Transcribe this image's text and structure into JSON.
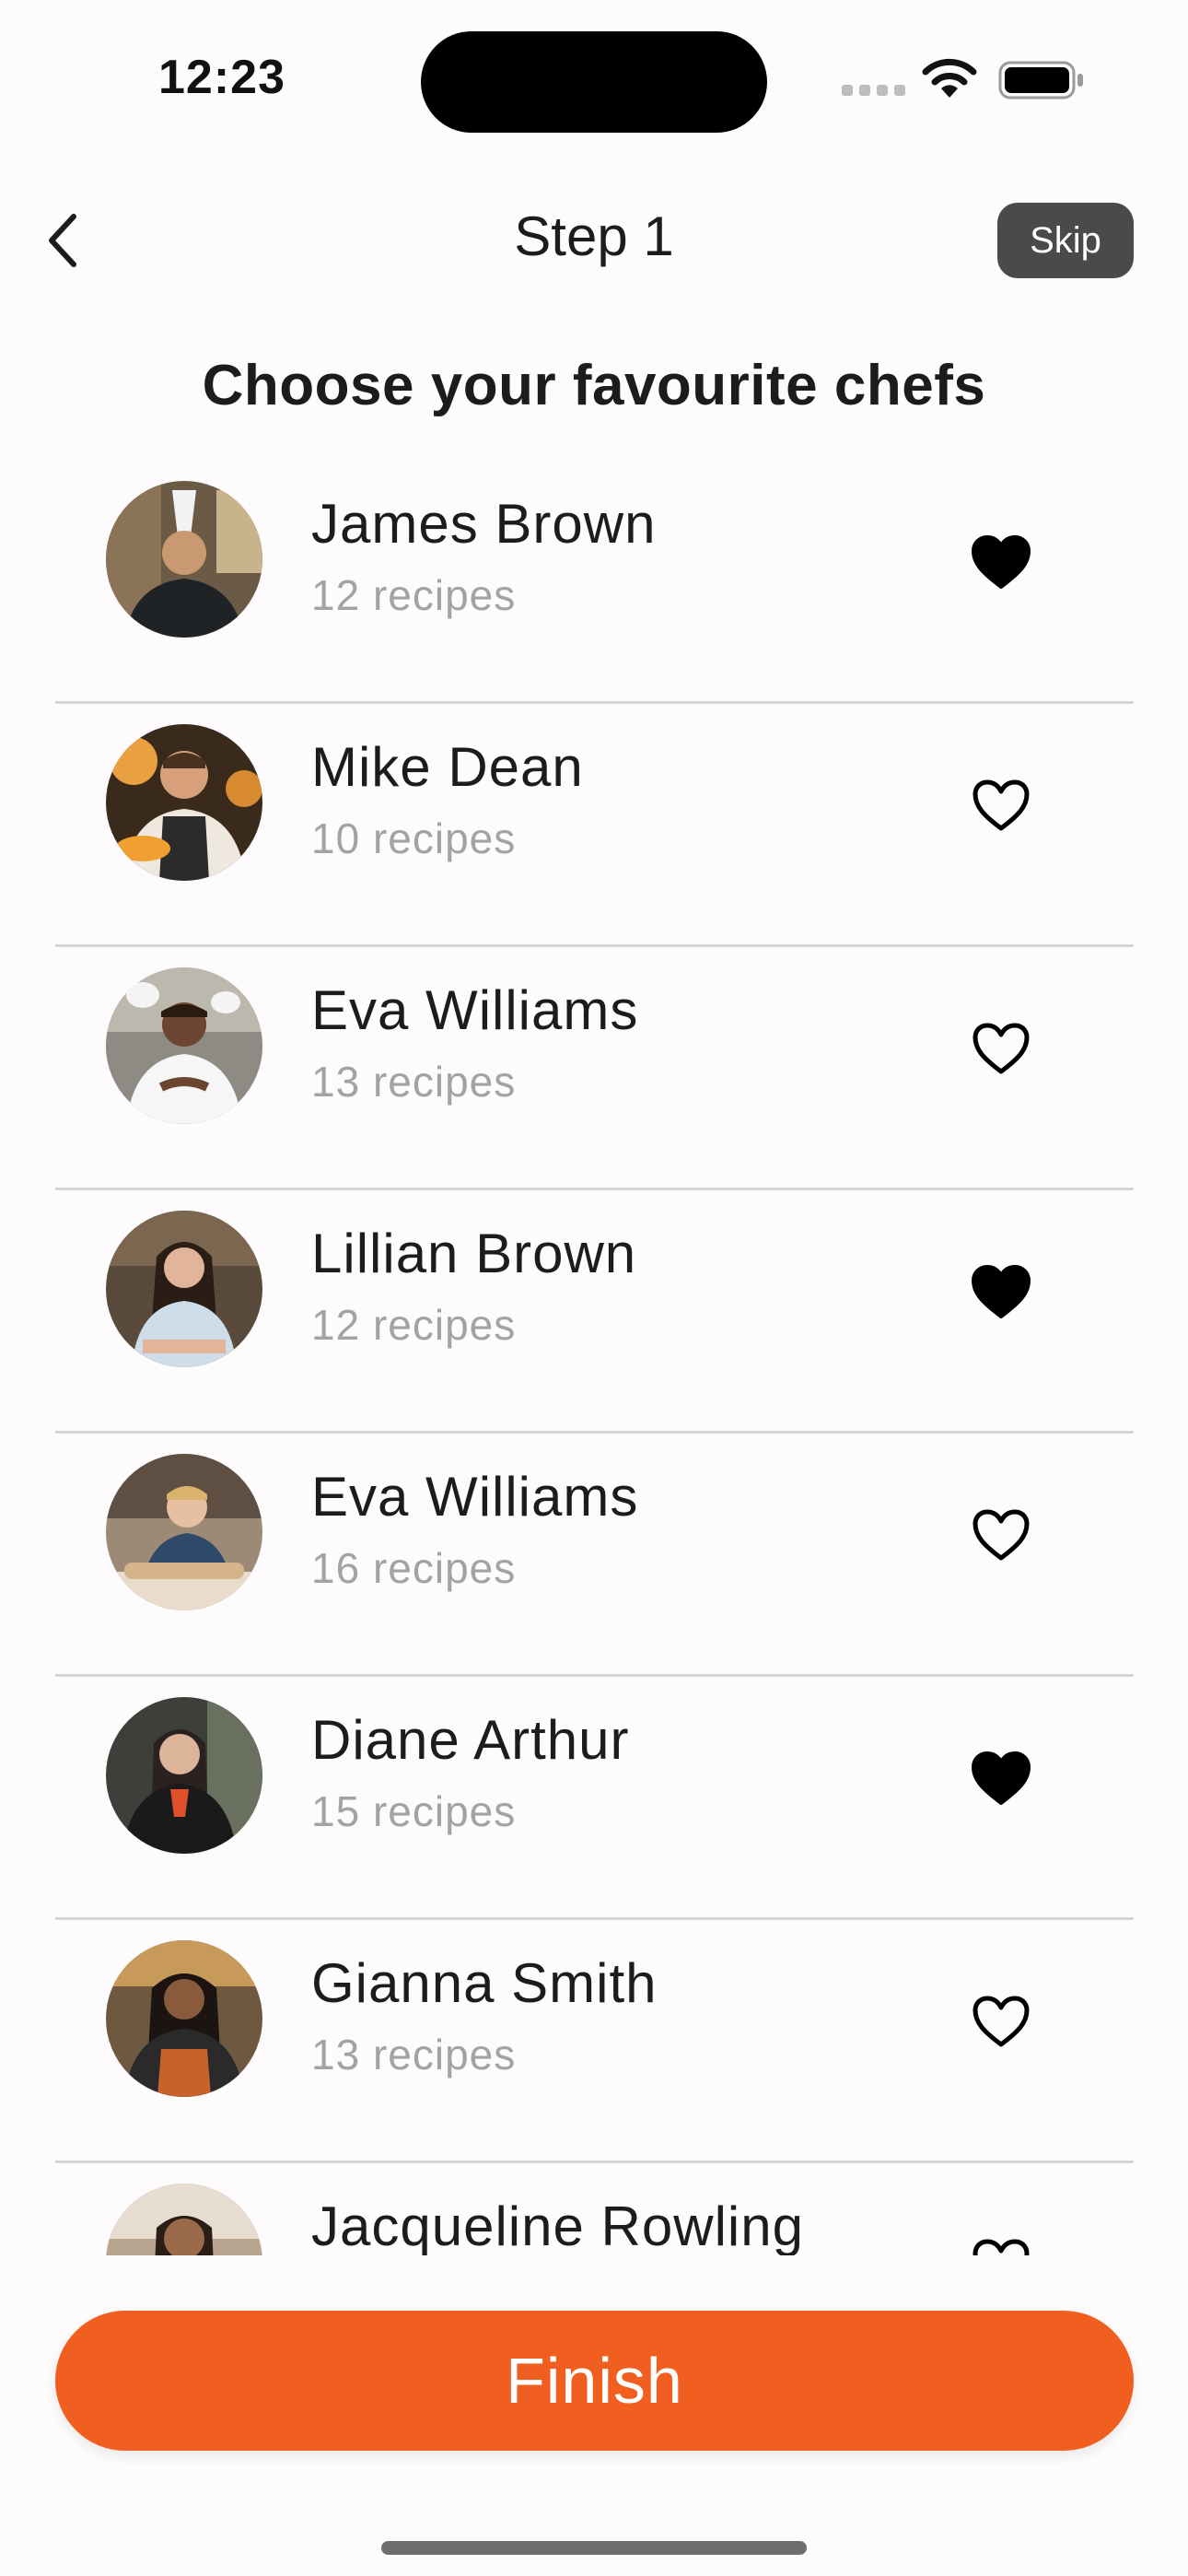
{
  "status_bar": {
    "time": "12:23"
  },
  "nav": {
    "title": "Step 1",
    "skip_label": "Skip"
  },
  "heading": "Choose your favourite chefs",
  "chefs": [
    {
      "name": "James Brown",
      "recipes": "12 recipes",
      "favourite": true
    },
    {
      "name": "Mike Dean",
      "recipes": "10 recipes",
      "favourite": false
    },
    {
      "name": "Eva Williams",
      "recipes": "13 recipes",
      "favourite": false
    },
    {
      "name": "Lillian Brown",
      "recipes": "12 recipes",
      "favourite": true
    },
    {
      "name": "Eva Williams",
      "recipes": "16 recipes",
      "favourite": false
    },
    {
      "name": "Diane Arthur",
      "recipes": "15 recipes",
      "favourite": true
    },
    {
      "name": "Gianna Smith",
      "recipes": "13 recipes",
      "favourite": false
    },
    {
      "name": "Jacqueline Rowling",
      "recipes": "",
      "favourite": false
    }
  ],
  "finish_label": "Finish",
  "icons": {
    "back": "chevron-left-icon",
    "heart_filled": "heart-filled-icon",
    "heart_outline": "heart-outline-icon"
  },
  "colors": {
    "accent": "#f15f20",
    "skip_bg": "#4a4a4a",
    "muted_text": "#a3a3a3"
  }
}
